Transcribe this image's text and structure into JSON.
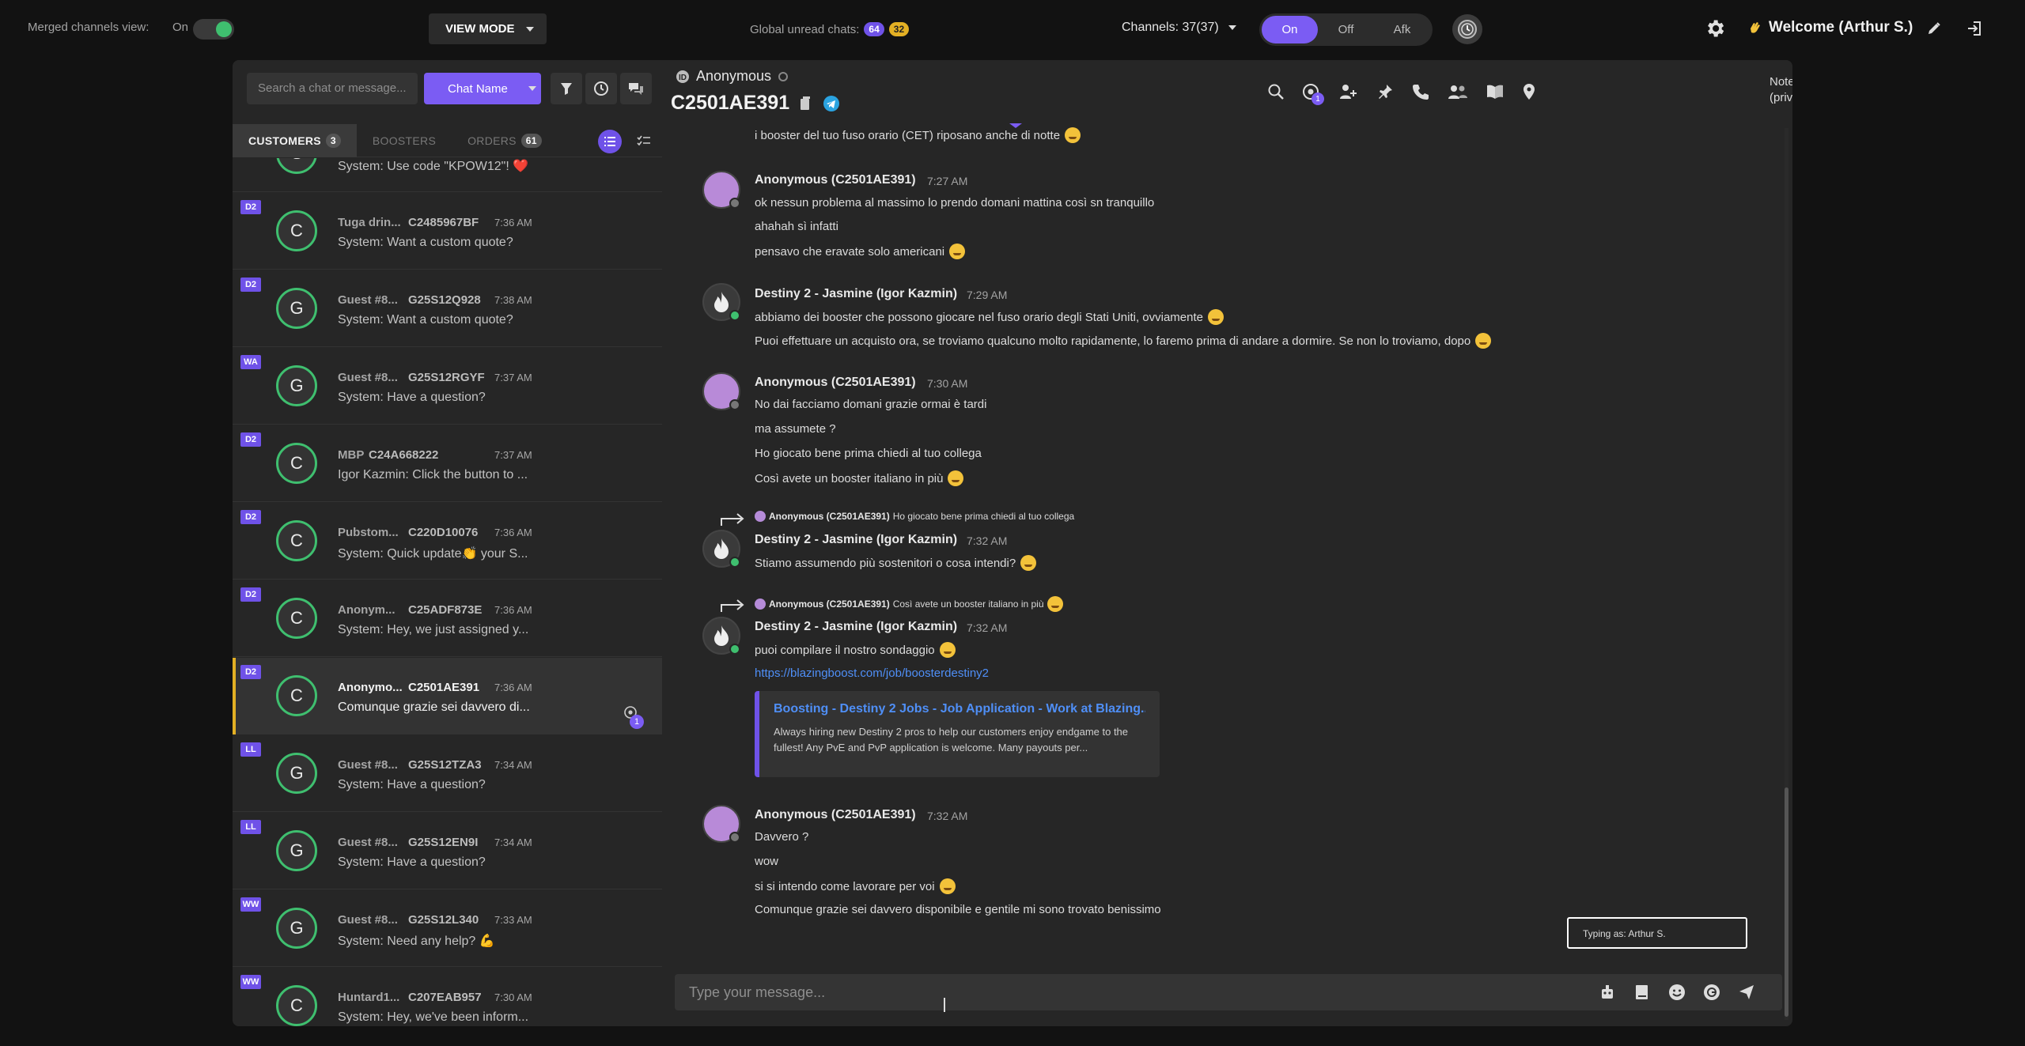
{
  "topbar": {
    "merged_label": "Merged channels view:",
    "merged_state": "On",
    "view_mode": "VIEW MODE",
    "unread_label": "Global unread chats:",
    "unread_a": "64",
    "unread_b": "32",
    "channels": "Channels: 37(37)",
    "status_on": "On",
    "status_off": "Off",
    "status_afk": "Afk",
    "welcome": "Welcome (Arthur S.)"
  },
  "sidebar": {
    "search_placeholder": "Search a chat or message...",
    "chat_name_btn": "Chat Name",
    "tabs": {
      "customers": "CUSTOMERS",
      "customers_count": "3",
      "boosters": "BOOSTERS",
      "orders": "ORDERS",
      "orders_count": "61"
    },
    "rows": [
      {
        "tag": "",
        "letter": "G",
        "name": "",
        "cid": "",
        "time": "",
        "preview": "System: Use code \"KPOW12\"! ❤️"
      },
      {
        "tag": "D2",
        "letter": "C",
        "name": "Tuga drin...",
        "cid": "C2485967BF",
        "time": "7:36 AM",
        "preview": "System: Want a custom quote?"
      },
      {
        "tag": "D2",
        "letter": "G",
        "name": "Guest #8...",
        "cid": "G25S12Q928",
        "time": "7:38 AM",
        "preview": "System: Want a custom quote?"
      },
      {
        "tag": "WA",
        "letter": "G",
        "name": "Guest #8...",
        "cid": "G25S12RGYF",
        "time": "7:37 AM",
        "preview": "System: Have a question?"
      },
      {
        "tag": "D2",
        "letter": "C",
        "name": "MBP",
        "cid": "C24A668222",
        "time": "7:37 AM",
        "preview": "Igor Kazmin: Click the button to ..."
      },
      {
        "tag": "D2",
        "letter": "C",
        "name": "Pubstom...",
        "cid": "C220D10076",
        "time": "7:36 AM",
        "preview": "System: Quick update👏 your S..."
      },
      {
        "tag": "D2",
        "letter": "C",
        "name": "Anonym...",
        "cid": "C25ADF873E",
        "time": "7:36 AM",
        "preview": "System: Hey, we just assigned y..."
      },
      {
        "tag": "D2",
        "letter": "C",
        "name": "Anonymo...",
        "cid": "C2501AE391",
        "time": "7:36 AM",
        "preview": "Comunque grazie sei davvero di...",
        "badge": "1"
      },
      {
        "tag": "LL",
        "letter": "G",
        "name": "Guest #8...",
        "cid": "G25S12TZA3",
        "time": "7:34 AM",
        "preview": "System: Have a question?"
      },
      {
        "tag": "LL",
        "letter": "G",
        "name": "Guest #8...",
        "cid": "G25S12EN9I",
        "time": "7:34 AM",
        "preview": "System: Have a question?"
      },
      {
        "tag": "WW",
        "letter": "G",
        "name": "Guest #8...",
        "cid": "G25S12L340",
        "time": "7:33 AM",
        "preview": "System: Need any help? 💪"
      },
      {
        "tag": "WW",
        "letter": "C",
        "name": "Huntard1...",
        "cid": "C207EAB957",
        "time": "7:30 AM",
        "preview": "System: Hey, we've been inform..."
      }
    ]
  },
  "chat": {
    "anon_label": "Anonymous",
    "chat_id": "C2501AE391",
    "eye_badge": "1",
    "note_label": "Note:",
    "note_sub": "(private)",
    "messages": {
      "m0_line": "i booster del tuo fuso orario (CET) riposano anche di notte",
      "g1_name": "Anonymous (C2501AE391)",
      "g1_time": "7:27 AM",
      "g1_l1": "ok nessun problema al massimo lo prendo domani mattina così sn tranquillo",
      "g1_l2": "ahahah sì infatti",
      "g1_l3": "pensavo che eravate solo americani",
      "g2_name": "Destiny 2 - Jasmine (Igor Kazmin)",
      "g2_time": "7:29 AM",
      "g2_l1": "abbiamo dei booster che possono giocare nel fuso orario degli Stati Uniti, ovviamente",
      "g2_l2": "Puoi effettuare un acquisto ora, se troviamo qualcuno molto rapidamente, lo faremo prima di andare a dormire. Se non lo troviamo, dopo",
      "g3_name": "Anonymous (C2501AE391)",
      "g3_time": "7:30 AM",
      "g3_l1": "No dai facciamo domani grazie ormai è tardi",
      "g3_l2": "ma assumete ?",
      "g3_l3": "Ho giocato bene prima chiedi al tuo collega",
      "g3_l4": "Così avete un booster italiano in più",
      "r1_author": "Anonymous (C2501AE391)",
      "r1_text": "Ho giocato bene prima chiedi al tuo collega",
      "g4_name": "Destiny 2 - Jasmine (Igor Kazmin)",
      "g4_time": "7:32 AM",
      "g4_l1": "Stiamo assumendo più sostenitori o cosa intendi?",
      "r2_author": "Anonymous (C2501AE391)",
      "r2_text": "Così avete un booster italiano in più",
      "g5_name": "Destiny 2 - Jasmine (Igor Kazmin)",
      "g5_time": "7:32 AM",
      "g5_l1": "puoi compilare il nostro sondaggio",
      "g5_link": "https://blazingboost.com/job/boosterdestiny2",
      "embed_title": "Boosting - Destiny 2 Jobs - Job Application - Work at Blazing...",
      "embed_desc": "Always hiring new Destiny 2 pros to help our customers enjoy endgame to the fullest! Any PvE and PvP application is welcome. Many payouts per...",
      "g6_name": "Anonymous (C2501AE391)",
      "g6_time": "7:32 AM",
      "g6_l1": "Davvero ?",
      "g6_l2": "wow",
      "g6_l3": "si si intendo come lavorare per voi",
      "g6_l4": "Comunque grazie sei davvero disponibile e gentile mi sono trovato benissimo"
    },
    "typing": "Typing as: Arthur S.",
    "composer_placeholder": "Type your message..."
  },
  "colors": {
    "accent": "#7b5cf3",
    "online": "#3fbf6f",
    "highlight": "#e3b024",
    "link": "#4f8ff7"
  }
}
